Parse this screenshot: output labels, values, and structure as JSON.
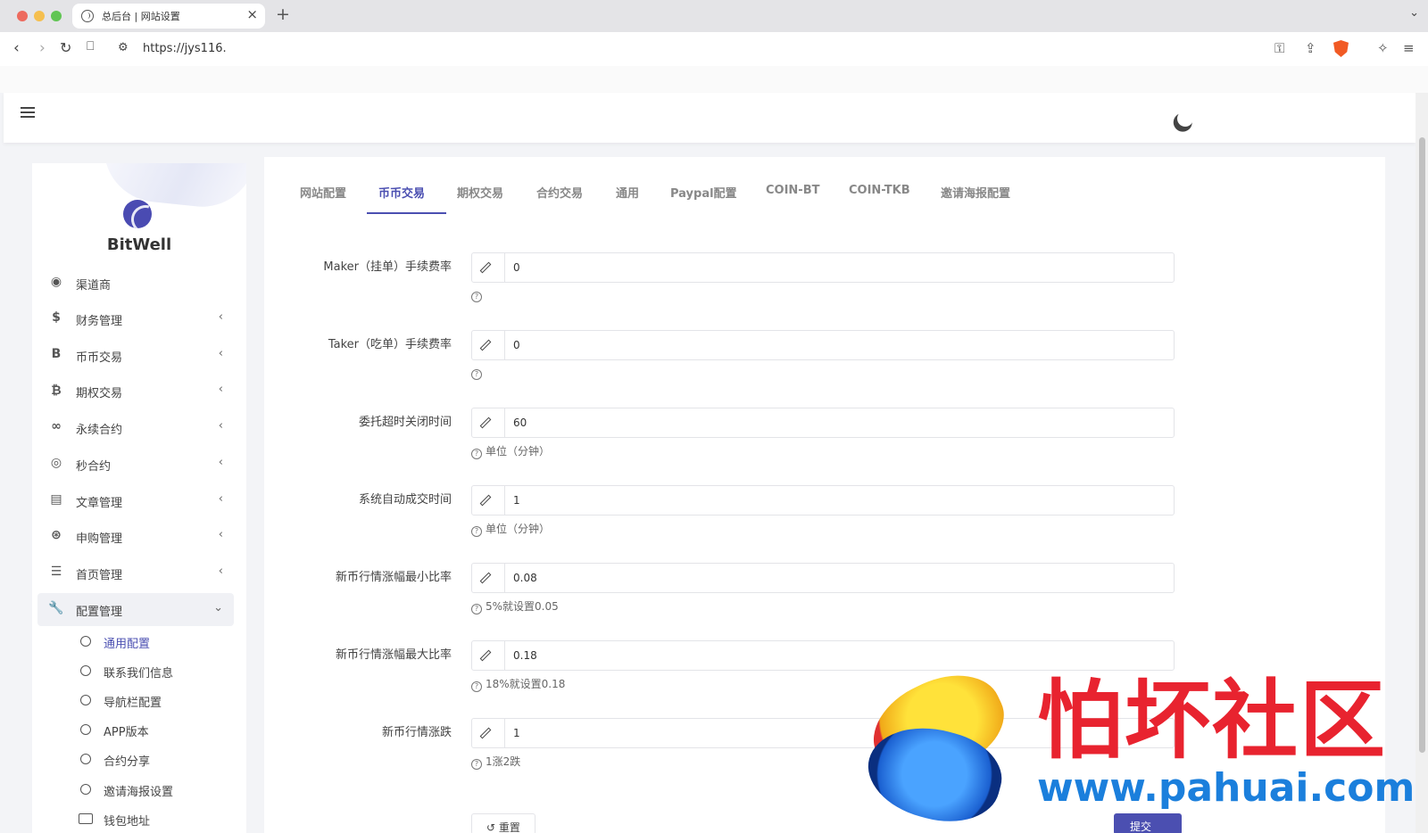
{
  "browser": {
    "tab_title": "总后台 | 网站设置",
    "url": "https://jys116."
  },
  "sidebar": {
    "brand": "BitWell",
    "menu": [
      {
        "label": "渠道商",
        "icon": "user-circle-icon",
        "has_arrow": false
      },
      {
        "label": "财务管理",
        "icon": "dollar-icon"
      },
      {
        "label": "币币交易",
        "icon": "b-letter-icon"
      },
      {
        "label": "期权交易",
        "icon": "bitcoin-icon"
      },
      {
        "label": "永续合约",
        "icon": "link-icon"
      },
      {
        "label": "秒合约",
        "icon": "target-icon"
      },
      {
        "label": "文章管理",
        "icon": "newspaper-icon"
      },
      {
        "label": "申购管理",
        "icon": "life-ring-icon"
      },
      {
        "label": "首页管理",
        "icon": "list-icon"
      },
      {
        "label": "配置管理",
        "icon": "wrench-icon"
      }
    ],
    "submenu": [
      {
        "label": "通用配置"
      },
      {
        "label": "联系我们信息"
      },
      {
        "label": "导航栏配置"
      },
      {
        "label": "APP版本"
      },
      {
        "label": "合约分享"
      },
      {
        "label": "邀请海报设置"
      },
      {
        "label": "钱包地址"
      }
    ]
  },
  "tabs": [
    {
      "label": "网站配置"
    },
    {
      "label": "币币交易"
    },
    {
      "label": "期权交易"
    },
    {
      "label": "合约交易"
    },
    {
      "label": "通用"
    },
    {
      "label": "Paypal配置"
    },
    {
      "label": "COIN-BT"
    },
    {
      "label": "COIN-TKB"
    },
    {
      "label": "邀请海报配置"
    }
  ],
  "form": {
    "fields": [
      {
        "label": "Maker（挂单）手续费率",
        "value": "0",
        "help": ""
      },
      {
        "label": "Taker（吃单）手续费率",
        "value": "0",
        "help": ""
      },
      {
        "label": "委托超时关闭时间",
        "value": "60",
        "help": "单位（分钟）"
      },
      {
        "label": "系统自动成交时间",
        "value": "1",
        "help": "单位（分钟）"
      },
      {
        "label": "新币行情涨幅最小比率",
        "value": "0.08",
        "help": "5%就设置0.05"
      },
      {
        "label": "新币行情涨幅最大比率",
        "value": "0.18",
        "help": "18%就设置0.18"
      },
      {
        "label": "新币行情涨跌",
        "value": "1",
        "help": "1涨2跌"
      }
    ],
    "reset_label": "↺ 重置",
    "submit_label": "提交"
  },
  "watermark": {
    "text": "怕坏社区",
    "url": "www.pahuai.com"
  },
  "colors": {
    "accent": "#4b4fb1",
    "watermark_red": "#e8232f",
    "watermark_blue": "#1b7fdc"
  }
}
